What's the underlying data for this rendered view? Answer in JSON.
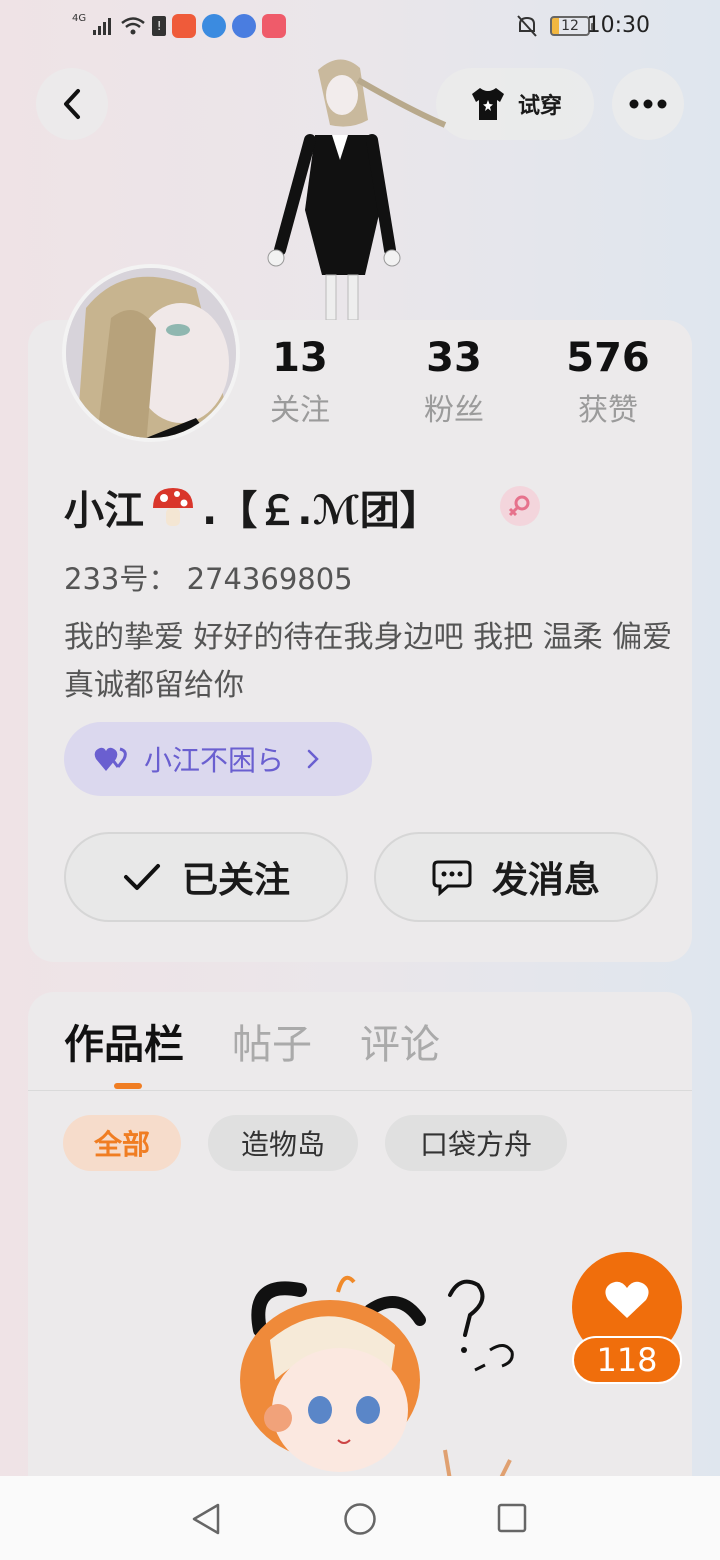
{
  "status_bar": {
    "network": "4G",
    "battery": "12",
    "time": "10:30"
  },
  "header": {
    "back_icon": "chevron-left-icon",
    "try_on_label": "试穿",
    "more_icon": "more-dots-icon"
  },
  "profile": {
    "stats": [
      {
        "value": "13",
        "label": "关注"
      },
      {
        "value": "33",
        "label": "粉丝"
      },
      {
        "value": "576",
        "label": "获赞"
      }
    ],
    "name_prefix": "小江",
    "name_suffix": ".【￡.ℳ团】",
    "gender_icon": "female-icon",
    "uid": "233号：  274369805",
    "bio": "我的挚爱 好好的待在我身边吧 我把 温柔 偏爱 真诚都留给你",
    "group_tag": "小江不困ら",
    "follow_button": "已关注",
    "message_button": "发消息"
  },
  "works": {
    "tabs": [
      "作品栏",
      "帖子",
      "评论"
    ],
    "active_tab": "作品栏",
    "filters": [
      "全部",
      "造物岛",
      "口袋方舟"
    ],
    "active_filter": "全部",
    "post_like_count": "118"
  },
  "colors": {
    "accent": "#f06e0c",
    "group_tag_bg": "#dbd8ee",
    "group_tag_text": "#6a5fd0"
  }
}
